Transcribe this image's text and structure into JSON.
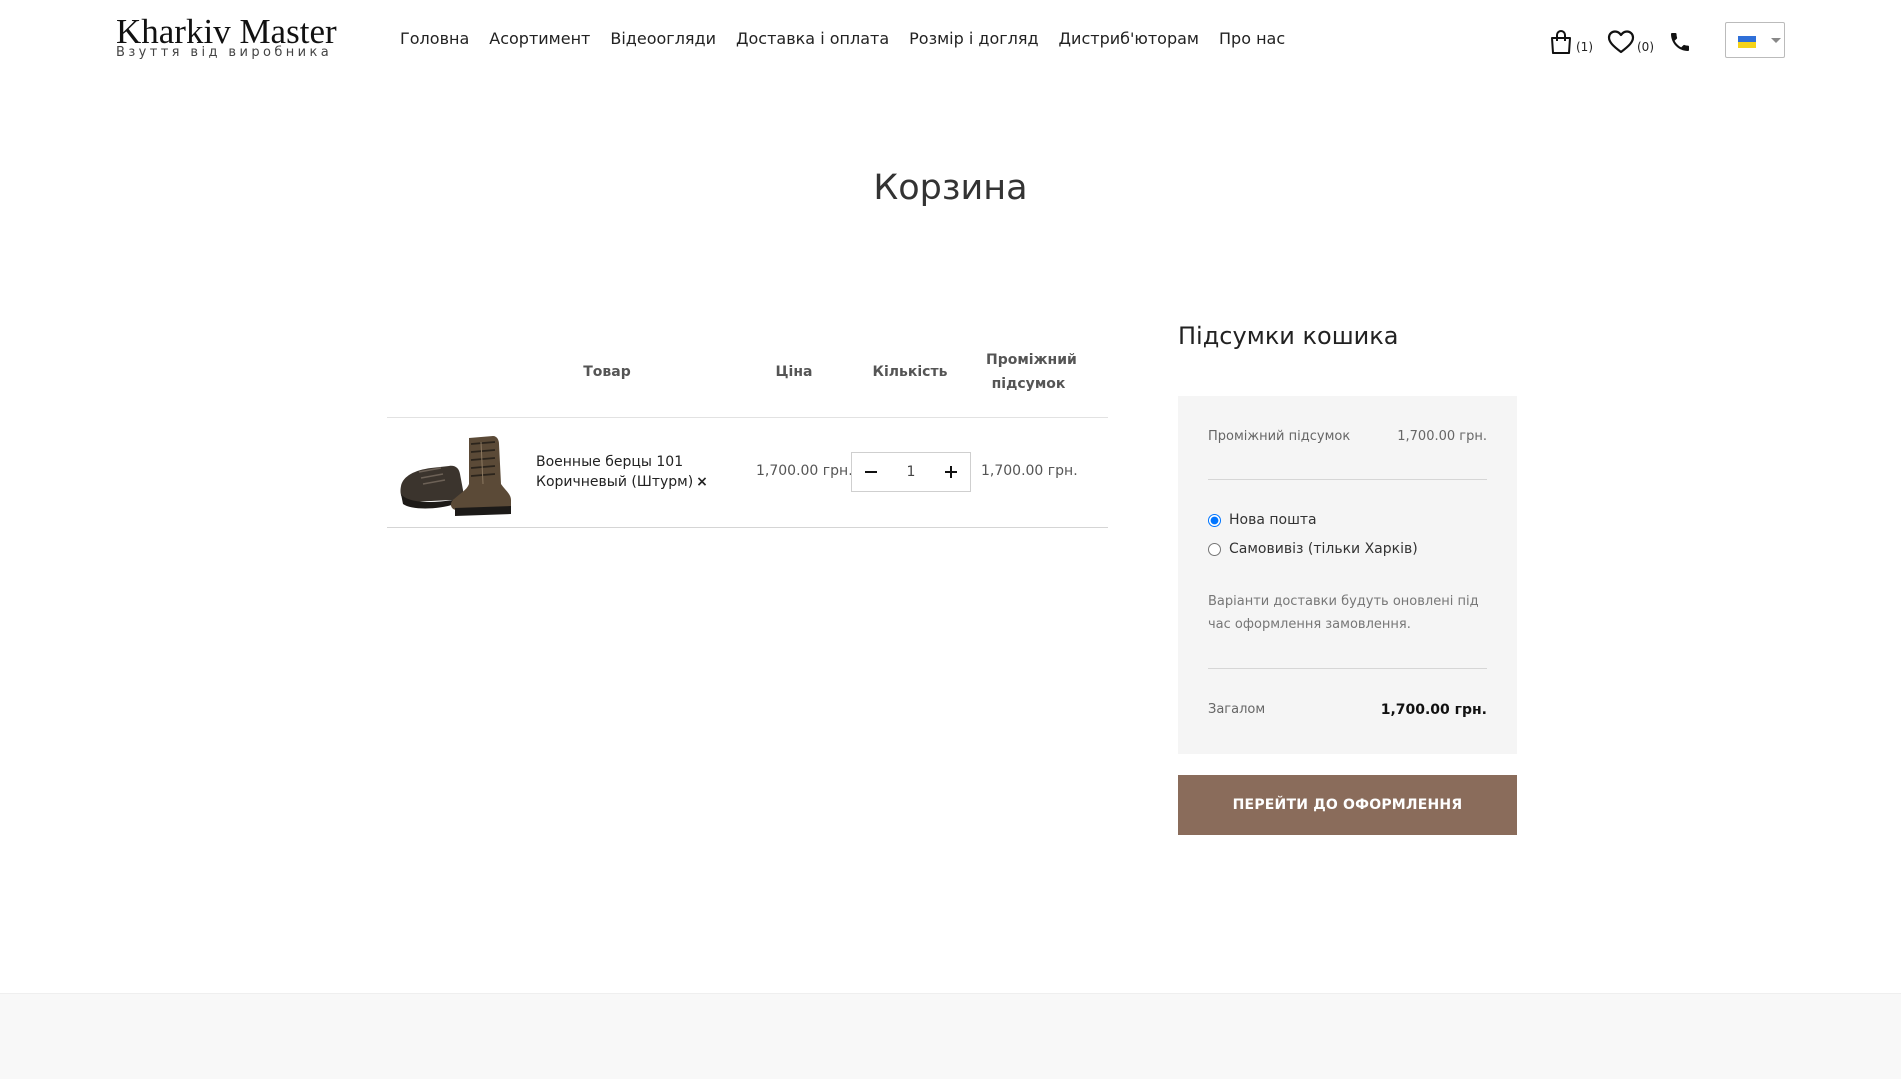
{
  "header": {
    "logo_title": "Kharkiv Master",
    "logo_subtitle": "Взуття від виробника",
    "nav": [
      {
        "label": "Головна"
      },
      {
        "label": "Асортимент"
      },
      {
        "label": "Відеоогляди"
      },
      {
        "label": "Доставка і оплата"
      },
      {
        "label": "Розмір і догляд"
      },
      {
        "label": "Дистриб'юторам"
      },
      {
        "label": "Про нас"
      }
    ],
    "cart_count": "(1)",
    "wishlist_count": "(0)",
    "icons": [
      "bag-icon",
      "heart-icon",
      "phone-icon",
      "flag-ua-icon",
      "caret-down-icon"
    ]
  },
  "page": {
    "title": "Корзина"
  },
  "cart": {
    "columns": {
      "product": "Товар",
      "price": "Ціна",
      "quantity": "Кількість",
      "subtotal": "Проміжний підсумок"
    },
    "items": [
      {
        "name": "Военные берцы 101 Коричневый (Штурм)",
        "remove": "×",
        "price": "1,700.00 грн.",
        "quantity": "1",
        "subtotal": "1,700.00 грн."
      }
    ]
  },
  "totals": {
    "title": "Підсумки кошика",
    "subtotal_label": "Проміжний підсумок",
    "subtotal_value": "1,700.00 грн.",
    "shipping_options": [
      {
        "label": "Нова пошта",
        "selected": true
      },
      {
        "label": "Самовивіз (тільки Харків)",
        "selected": false
      }
    ],
    "shipping_note": "Варіанти доставки будуть оновлені під час оформлення замовлення.",
    "total_label": "Загалом",
    "total_value": "1,700.00 грн.",
    "checkout_label": "ПЕРЕЙТИ ДО ОФОРМЛЕННЯ"
  },
  "colors": {
    "checkout_button": "#8a6c5b",
    "totals_background": "#f5f5f5"
  }
}
